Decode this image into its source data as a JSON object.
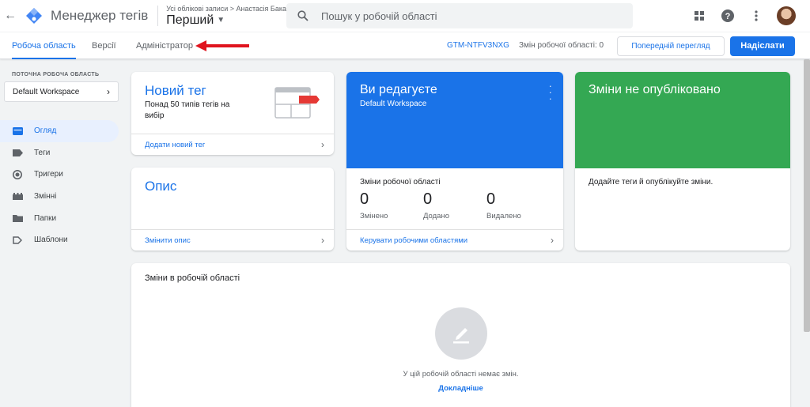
{
  "header": {
    "app_title": "Менеджер тегів",
    "breadcrumb": "Усі облікові записи > Анастасія Бакай",
    "container_name": "Перший",
    "search_placeholder": "Пошук у робочій області"
  },
  "tabs": [
    {
      "label": "Робоча область",
      "active": true
    },
    {
      "label": "Версії",
      "active": false
    },
    {
      "label": "Адміністратор",
      "active": false
    }
  ],
  "toolbar": {
    "container_id": "GTM-NTFV3NXG",
    "workspace_changes": "Змін робочої області: 0",
    "preview_label": "Попередній перегляд",
    "submit_label": "Надіслати"
  },
  "sidebar": {
    "workspace_label": "ПОТОЧНА РОБОЧА ОБЛАСТЬ",
    "workspace_name": "Default Workspace",
    "items": [
      {
        "label": "Огляд",
        "icon": "overview-icon",
        "active": true
      },
      {
        "label": "Теги",
        "icon": "tag-icon",
        "active": false
      },
      {
        "label": "Тригери",
        "icon": "trigger-icon",
        "active": false
      },
      {
        "label": "Змінні",
        "icon": "variable-icon",
        "active": false
      },
      {
        "label": "Папки",
        "icon": "folder-icon",
        "active": false
      },
      {
        "label": "Шаблони",
        "icon": "template-icon",
        "active": false
      }
    ]
  },
  "new_tag_card": {
    "title": "Новий тег",
    "description": "Понад 50 типів тегів на вибір",
    "link": "Додати новий тег"
  },
  "description_card": {
    "title": "Опис",
    "link": "Змінити опис"
  },
  "editing_card": {
    "title": "Ви редагуєте",
    "workspace": "Default Workspace",
    "changes_label": "Зміни робочої області",
    "stats": [
      {
        "value": "0",
        "label": "Змінено"
      },
      {
        "value": "0",
        "label": "Додано"
      },
      {
        "value": "0",
        "label": "Видалено"
      }
    ],
    "link": "Керувати робочими областями"
  },
  "unpublished_card": {
    "title": "Зміни не опубліковано",
    "text": "Додайте теги й опублікуйте зміни."
  },
  "workspace_changes_card": {
    "title": "Зміни в робочій області",
    "empty_text": "У цій робочій області немає змін.",
    "learn_more": "Докладніше"
  },
  "colors": {
    "accent": "#1a73e8",
    "green": "#34a853",
    "annotation_arrow": "#e0141e"
  }
}
